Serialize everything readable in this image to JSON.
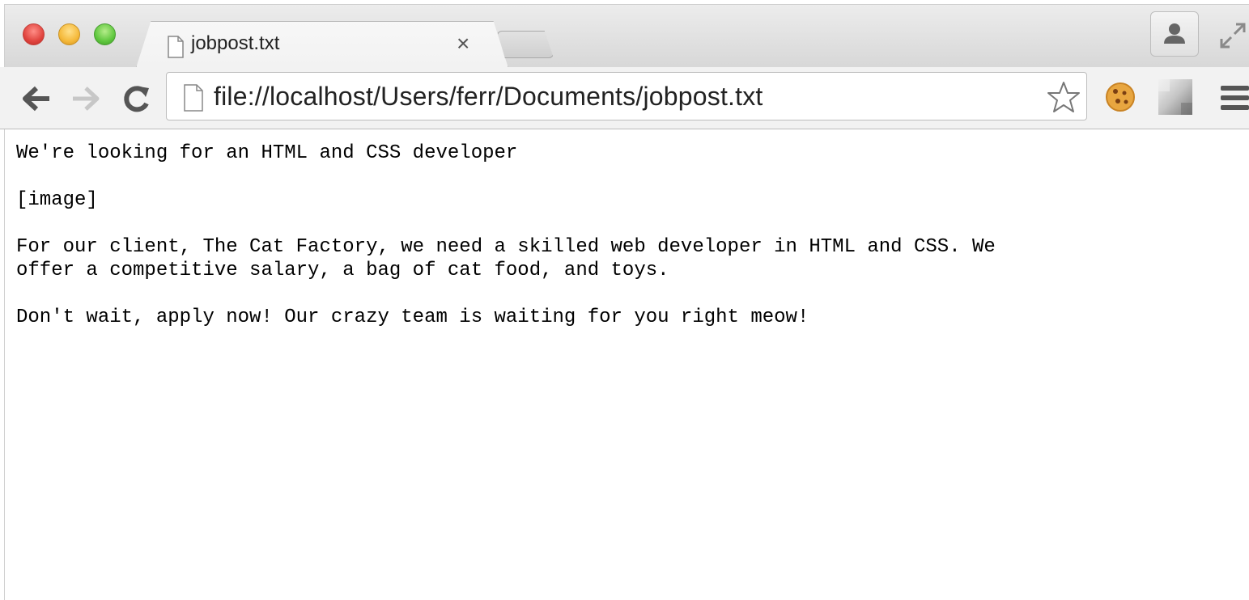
{
  "tab": {
    "title": "jobpost.txt",
    "close_label": "×"
  },
  "address_bar": {
    "url": "file://localhost/Users/ferr/Documents/jobpost.txt"
  },
  "icons": {
    "window_controls": [
      "close-traffic-light",
      "minimize-traffic-light",
      "zoom-traffic-light"
    ],
    "tab_favicon": "document-icon",
    "profile": "person-icon",
    "resize": "fullscreen-arrows-icon",
    "back": "back-arrow-icon",
    "forward": "forward-arrow-icon",
    "reload": "reload-icon",
    "page": "document-icon",
    "bookmark": "star-icon",
    "extension_1": "cookie-icon",
    "extension_2": "gradient-grid-icon",
    "menu": "hamburger-menu-icon"
  },
  "colors": {
    "traffic_red": "#e0443e",
    "traffic_yellow": "#f5b93a",
    "traffic_green": "#5fc73e",
    "toolbar_bg": "#f2f2f2"
  },
  "document": {
    "heading": "We're looking for an HTML and CSS developer",
    "image_placeholder": "[image]",
    "paragraph_1": "For our client, The Cat Factory, we need a skilled web developer in HTML and CSS. We\noffer a competitive salary, a bag of cat food, and toys.",
    "paragraph_2": "Don't wait, apply now! Our crazy team is waiting for you right meow!"
  }
}
